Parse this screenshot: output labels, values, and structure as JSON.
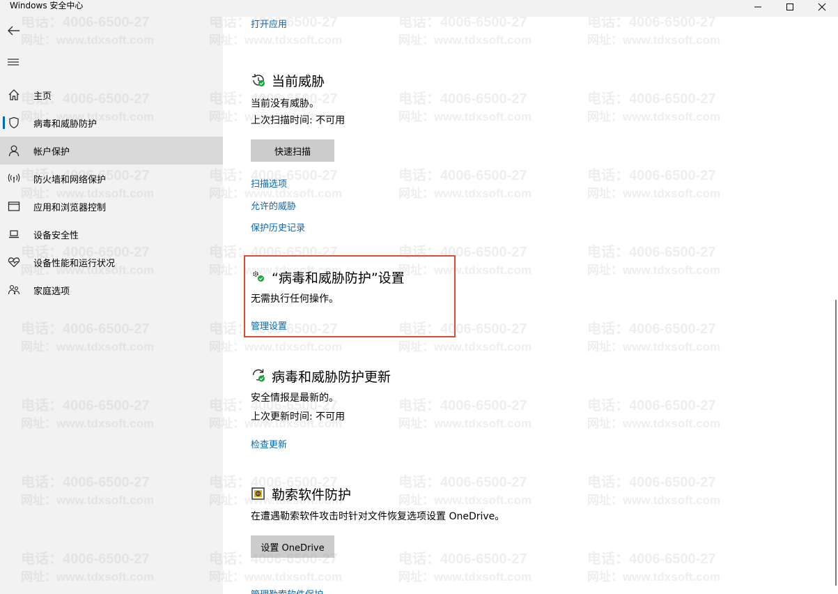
{
  "window": {
    "title": "Windows 安全中心",
    "controls": {
      "minimize": "—",
      "maximize": "☐",
      "close": "✕"
    }
  },
  "sidebar": {
    "items": [
      {
        "label": "主页",
        "icon": "home-icon"
      },
      {
        "label": "病毒和威胁防护",
        "icon": "shield-icon"
      },
      {
        "label": "帐户保护",
        "icon": "person-icon"
      },
      {
        "label": "防火墙和网络保护",
        "icon": "wireless-icon"
      },
      {
        "label": "应用和浏览器控制",
        "icon": "app-window-icon"
      },
      {
        "label": "设备安全性",
        "icon": "laptop-icon"
      },
      {
        "label": "设备性能和运行状况",
        "icon": "heart-pulse-icon"
      },
      {
        "label": "家庭选项",
        "icon": "family-icon"
      }
    ],
    "selected_index": 2,
    "active_indicator_index": 1
  },
  "content": {
    "open_app_link": "打开应用",
    "current_threats": {
      "title": "当前威胁",
      "status": "当前没有威胁。",
      "last_scan": "上次扫描时间: 不可用",
      "quick_scan_button": "快速扫描",
      "links": [
        "扫描选项",
        "允许的威胁",
        "保护历史记录"
      ]
    },
    "settings": {
      "title": "“病毒和威胁防护”设置",
      "status": "无需执行任何操作。",
      "manage_link": "管理设置"
    },
    "updates": {
      "title": "病毒和威胁防护更新",
      "status": "安全情报是最新的。",
      "last_update": "上次更新时间: 不可用",
      "check_link": "检查更新"
    },
    "ransomware": {
      "title": "勒索软件防护",
      "description": "在遭遇勒索软件攻击时针对文件恢复选项设置 OneDrive。",
      "setup_button": "设置 OneDrive",
      "manage_link": "管理勒索软件保护"
    }
  },
  "watermark": {
    "phone": "电话：4006-6500-27",
    "site": "网址：www.tdxsoft.com"
  },
  "colors": {
    "accent": "#0067b8",
    "sidebar_bg": "#f2f2f2",
    "selected_bg": "#d9d9d9",
    "highlight_border": "#e0492f",
    "ok_green": "#16a33a"
  }
}
